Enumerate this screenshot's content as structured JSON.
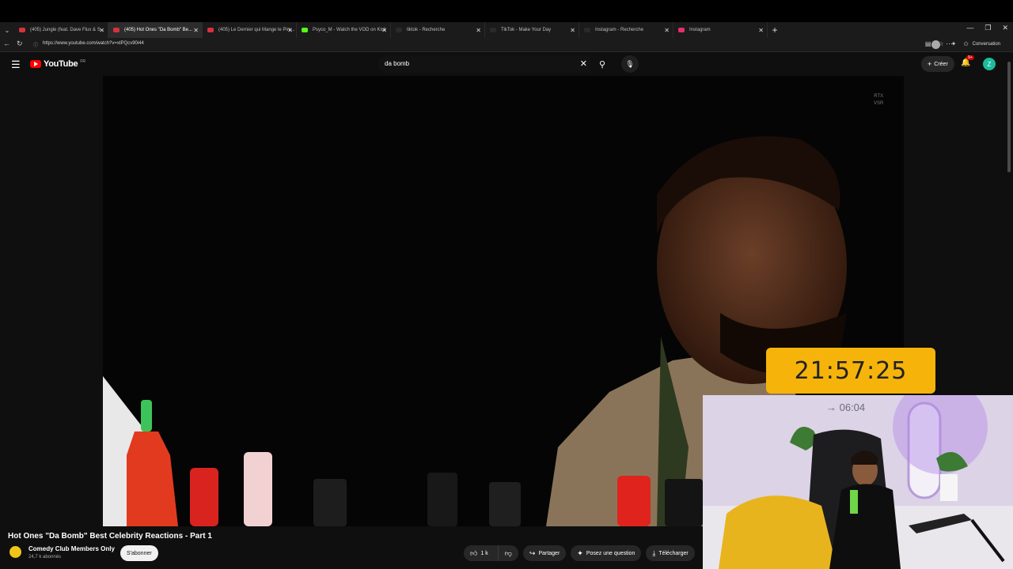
{
  "browser": {
    "tabs": [
      {
        "label": "(405) Jungle (feat. Dave Flux & S...",
        "fav": "#d9303e",
        "active": false
      },
      {
        "label": "(405) Hot Ones \"Da Bomb\" Be...",
        "fav": "#d9303e",
        "active": true
      },
      {
        "label": "(405) Le Dernier qui Mange le Pim...",
        "fav": "#d9303e",
        "active": false
      },
      {
        "label": "Psyco_M - Watch the VOD on Kick",
        "fav": "#53fc18",
        "active": false
      },
      {
        "label": "tiktok - Recherche",
        "fav": "#2a2a2a",
        "active": false
      },
      {
        "label": "TikTok - Make Your Day",
        "fav": "#2a2a2a",
        "active": false
      },
      {
        "label": "Instagram - Recherche",
        "fav": "#2a2a2a",
        "active": false
      },
      {
        "label": "Instagram",
        "fav": "#e1306c",
        "active": false
      }
    ],
    "new_tab": "+",
    "url": "https://www.youtube.com/watch?v=xtPQcv90i44",
    "conversation_label": "Conversation"
  },
  "youtube": {
    "logo_text": "YouTube",
    "logo_region": "FR",
    "search_query": "da bomb",
    "create_label": "Créer",
    "notif_badge": "9+",
    "avatar_letter": "Z"
  },
  "player": {
    "rtx_line1": "RTX",
    "rtx_line2": "VSR"
  },
  "overlay": {
    "clock": "21:57:25",
    "subtitle": "→ 06:04"
  },
  "video": {
    "title": "Hot Ones \"Da Bomb\" Best Celebrity Reactions - Part 1",
    "channel": "Comedy Club Members Only",
    "subscribers": "24,7 k abonnés",
    "subscribe_label": "S'abonner",
    "likes": "1 k",
    "share_label": "Partager",
    "ask_label": "Posez une question",
    "download_label": "Télécharger"
  },
  "colors": {
    "timer_bg": "#f6b40a",
    "youtube_red": "#ff0000"
  }
}
